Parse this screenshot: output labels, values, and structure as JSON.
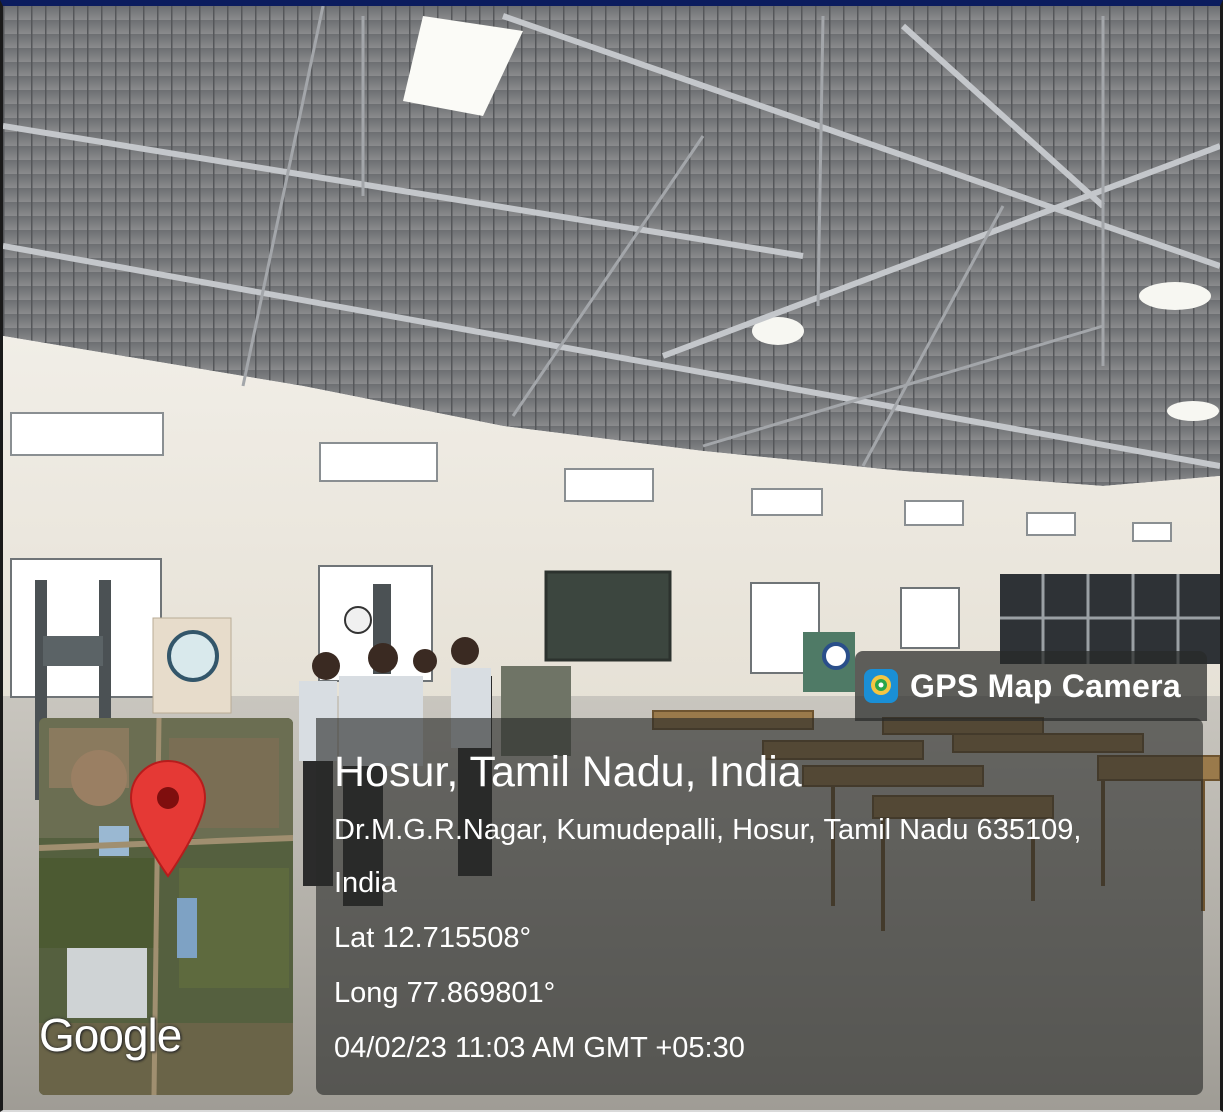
{
  "badge": {
    "title": "GPS Map Camera",
    "icon": "gps-map-camera-app-icon"
  },
  "location": {
    "city": "Hosur, Tamil Nadu, India",
    "address_line1": "Dr.M.G.R.Nagar, Kumudepalli, Hosur, Tamil Nadu 635109,",
    "address_line2": "India",
    "latitude": "Lat 12.715508°",
    "longitude": "Long 77.869801°",
    "datetime": "04/02/23 11:03 AM GMT +05:30"
  },
  "map": {
    "provider_logo": "Google",
    "pin_icon": "map-pin-icon",
    "pin_color": "#e53935"
  },
  "colors": {
    "top_border": "#0b1c5e",
    "overlay": "#282a28"
  }
}
